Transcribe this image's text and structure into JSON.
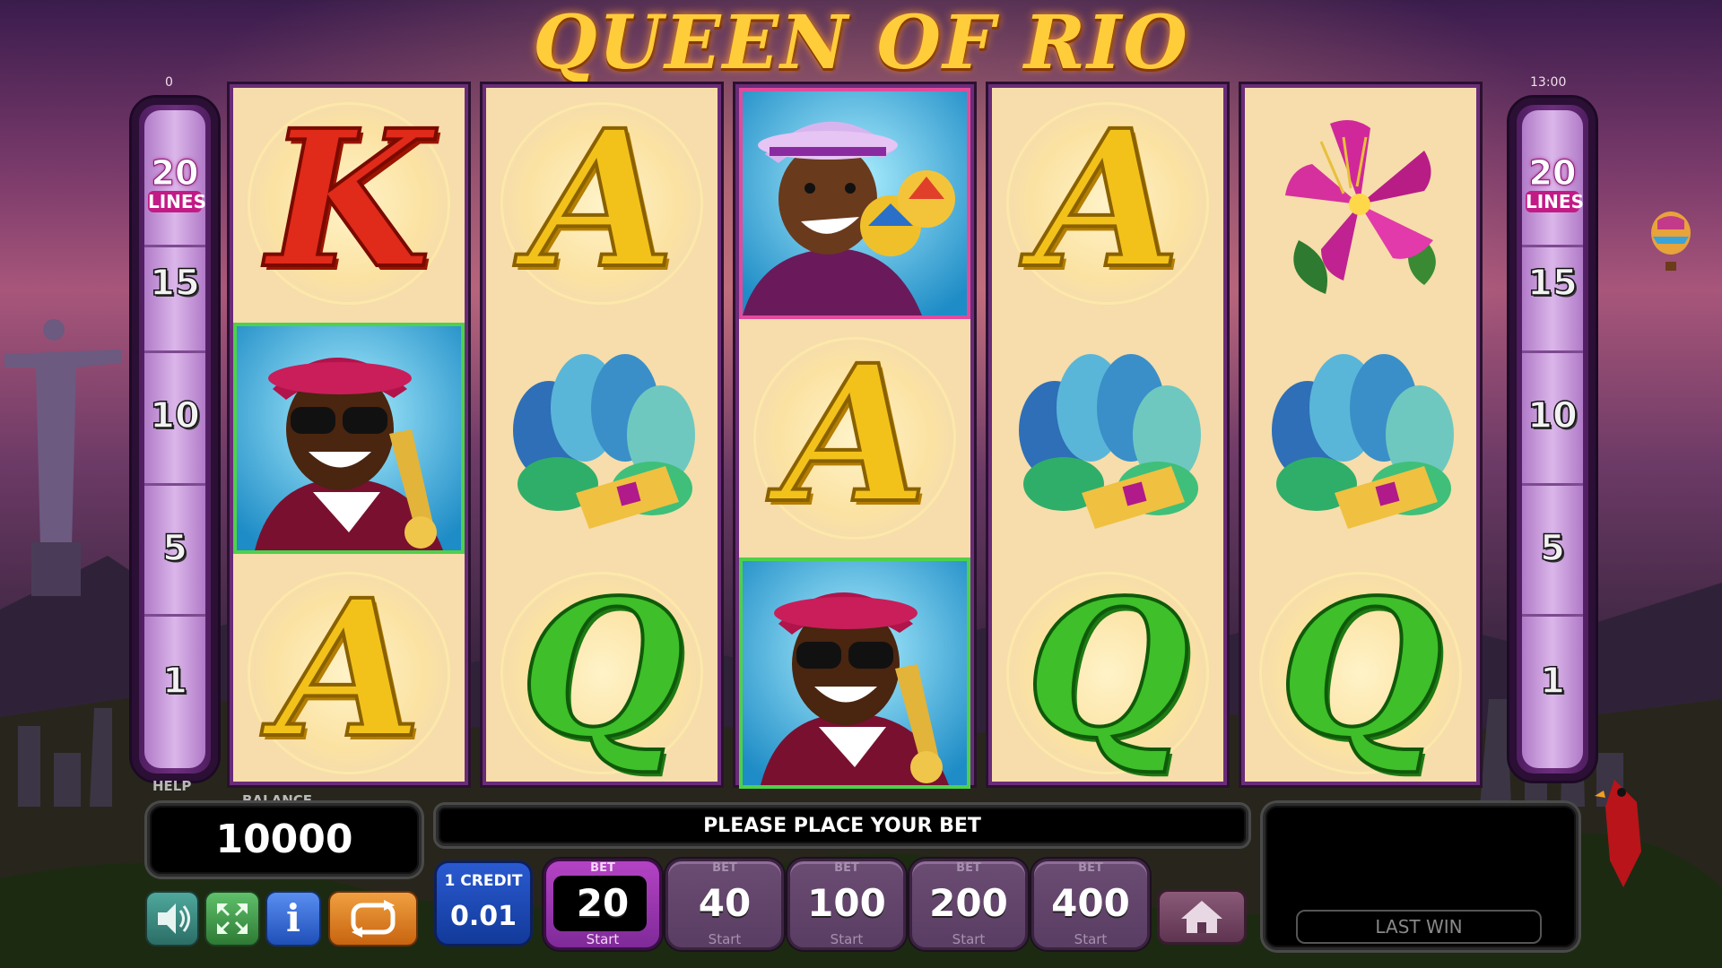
{
  "game": {
    "title": "QUEEN OF RIO",
    "corner_left": "0",
    "clock": "13:00"
  },
  "lines_panel": {
    "left": {
      "badge_number": "20",
      "badge_label": "LINES",
      "numbers": [
        "15",
        "10",
        "5",
        "1"
      ]
    },
    "right": {
      "badge_number": "20",
      "badge_label": "LINES",
      "numbers": [
        "15",
        "10",
        "5",
        "1"
      ]
    }
  },
  "reels": [
    [
      "K",
      "trumpet-player",
      "A"
    ],
    [
      "A",
      "feather-headdress",
      "Q"
    ],
    [
      "maracas-player",
      "A",
      "trumpet-player"
    ],
    [
      "A",
      "feather-headdress",
      "Q"
    ],
    [
      "flower",
      "feather-headdress",
      "Q"
    ]
  ],
  "controls": {
    "help_label": "HELP",
    "balance_label": "BALANCE",
    "balance_value": "10000",
    "message": "PLEASE PLACE YOUR BET",
    "credit_label": "1 CREDIT",
    "credit_value": "0.01",
    "last_win_label": "LAST WIN",
    "bet_label": "BET",
    "start_label": "Start",
    "bets": [
      "20",
      "40",
      "100",
      "200",
      "400"
    ],
    "active_bet": "20",
    "info_glyph": "i"
  },
  "icons": [
    "sound-icon",
    "fullscreen-icon",
    "info-icon",
    "autoplay-icon",
    "home-icon"
  ],
  "colors": {
    "accent": "#c21b86",
    "reel_bg": "#f6ddab",
    "frame": "#6a2c78",
    "win_green": "#4ed14a",
    "win_pink": "#e24b9c"
  }
}
